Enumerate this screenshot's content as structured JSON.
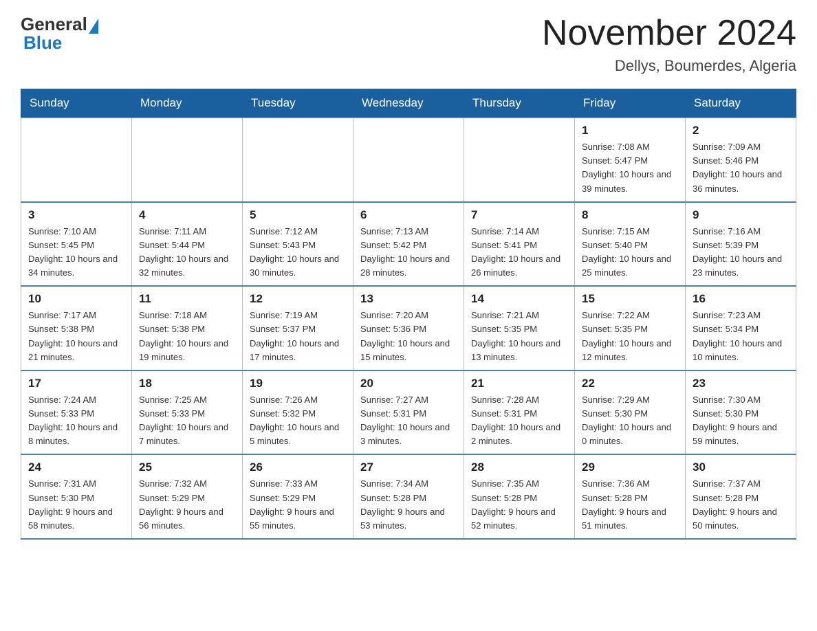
{
  "header": {
    "logo": {
      "general": "General",
      "blue": "Blue"
    },
    "title": "November 2024",
    "location": "Dellys, Boumerdes, Algeria"
  },
  "days_of_week": [
    "Sunday",
    "Monday",
    "Tuesday",
    "Wednesday",
    "Thursday",
    "Friday",
    "Saturday"
  ],
  "weeks": [
    [
      {
        "day": "",
        "info": ""
      },
      {
        "day": "",
        "info": ""
      },
      {
        "day": "",
        "info": ""
      },
      {
        "day": "",
        "info": ""
      },
      {
        "day": "",
        "info": ""
      },
      {
        "day": "1",
        "info": "Sunrise: 7:08 AM\nSunset: 5:47 PM\nDaylight: 10 hours and 39 minutes."
      },
      {
        "day": "2",
        "info": "Sunrise: 7:09 AM\nSunset: 5:46 PM\nDaylight: 10 hours and 36 minutes."
      }
    ],
    [
      {
        "day": "3",
        "info": "Sunrise: 7:10 AM\nSunset: 5:45 PM\nDaylight: 10 hours and 34 minutes."
      },
      {
        "day": "4",
        "info": "Sunrise: 7:11 AM\nSunset: 5:44 PM\nDaylight: 10 hours and 32 minutes."
      },
      {
        "day": "5",
        "info": "Sunrise: 7:12 AM\nSunset: 5:43 PM\nDaylight: 10 hours and 30 minutes."
      },
      {
        "day": "6",
        "info": "Sunrise: 7:13 AM\nSunset: 5:42 PM\nDaylight: 10 hours and 28 minutes."
      },
      {
        "day": "7",
        "info": "Sunrise: 7:14 AM\nSunset: 5:41 PM\nDaylight: 10 hours and 26 minutes."
      },
      {
        "day": "8",
        "info": "Sunrise: 7:15 AM\nSunset: 5:40 PM\nDaylight: 10 hours and 25 minutes."
      },
      {
        "day": "9",
        "info": "Sunrise: 7:16 AM\nSunset: 5:39 PM\nDaylight: 10 hours and 23 minutes."
      }
    ],
    [
      {
        "day": "10",
        "info": "Sunrise: 7:17 AM\nSunset: 5:38 PM\nDaylight: 10 hours and 21 minutes."
      },
      {
        "day": "11",
        "info": "Sunrise: 7:18 AM\nSunset: 5:38 PM\nDaylight: 10 hours and 19 minutes."
      },
      {
        "day": "12",
        "info": "Sunrise: 7:19 AM\nSunset: 5:37 PM\nDaylight: 10 hours and 17 minutes."
      },
      {
        "day": "13",
        "info": "Sunrise: 7:20 AM\nSunset: 5:36 PM\nDaylight: 10 hours and 15 minutes."
      },
      {
        "day": "14",
        "info": "Sunrise: 7:21 AM\nSunset: 5:35 PM\nDaylight: 10 hours and 13 minutes."
      },
      {
        "day": "15",
        "info": "Sunrise: 7:22 AM\nSunset: 5:35 PM\nDaylight: 10 hours and 12 minutes."
      },
      {
        "day": "16",
        "info": "Sunrise: 7:23 AM\nSunset: 5:34 PM\nDaylight: 10 hours and 10 minutes."
      }
    ],
    [
      {
        "day": "17",
        "info": "Sunrise: 7:24 AM\nSunset: 5:33 PM\nDaylight: 10 hours and 8 minutes."
      },
      {
        "day": "18",
        "info": "Sunrise: 7:25 AM\nSunset: 5:33 PM\nDaylight: 10 hours and 7 minutes."
      },
      {
        "day": "19",
        "info": "Sunrise: 7:26 AM\nSunset: 5:32 PM\nDaylight: 10 hours and 5 minutes."
      },
      {
        "day": "20",
        "info": "Sunrise: 7:27 AM\nSunset: 5:31 PM\nDaylight: 10 hours and 3 minutes."
      },
      {
        "day": "21",
        "info": "Sunrise: 7:28 AM\nSunset: 5:31 PM\nDaylight: 10 hours and 2 minutes."
      },
      {
        "day": "22",
        "info": "Sunrise: 7:29 AM\nSunset: 5:30 PM\nDaylight: 10 hours and 0 minutes."
      },
      {
        "day": "23",
        "info": "Sunrise: 7:30 AM\nSunset: 5:30 PM\nDaylight: 9 hours and 59 minutes."
      }
    ],
    [
      {
        "day": "24",
        "info": "Sunrise: 7:31 AM\nSunset: 5:30 PM\nDaylight: 9 hours and 58 minutes."
      },
      {
        "day": "25",
        "info": "Sunrise: 7:32 AM\nSunset: 5:29 PM\nDaylight: 9 hours and 56 minutes."
      },
      {
        "day": "26",
        "info": "Sunrise: 7:33 AM\nSunset: 5:29 PM\nDaylight: 9 hours and 55 minutes."
      },
      {
        "day": "27",
        "info": "Sunrise: 7:34 AM\nSunset: 5:28 PM\nDaylight: 9 hours and 53 minutes."
      },
      {
        "day": "28",
        "info": "Sunrise: 7:35 AM\nSunset: 5:28 PM\nDaylight: 9 hours and 52 minutes."
      },
      {
        "day": "29",
        "info": "Sunrise: 7:36 AM\nSunset: 5:28 PM\nDaylight: 9 hours and 51 minutes."
      },
      {
        "day": "30",
        "info": "Sunrise: 7:37 AM\nSunset: 5:28 PM\nDaylight: 9 hours and 50 minutes."
      }
    ]
  ]
}
